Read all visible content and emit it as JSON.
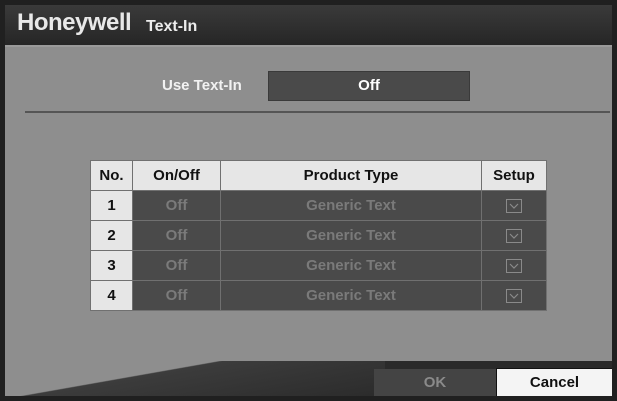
{
  "header": {
    "brand": "Honeywell",
    "title": "Text-In"
  },
  "use_text_in": {
    "label": "Use Text-In",
    "value": "Off"
  },
  "table": {
    "headers": [
      "No.",
      "On/Off",
      "Product Type",
      "Setup"
    ],
    "rows": [
      {
        "no": "1",
        "state": "Off",
        "product": "Generic Text",
        "setup_icon": "setup-check-icon"
      },
      {
        "no": "2",
        "state": "Off",
        "product": "Generic Text",
        "setup_icon": "setup-check-icon"
      },
      {
        "no": "3",
        "state": "Off",
        "product": "Generic Text",
        "setup_icon": "setup-check-icon"
      },
      {
        "no": "4",
        "state": "Off",
        "product": "Generic Text",
        "setup_icon": "setup-check-icon"
      }
    ]
  },
  "buttons": {
    "ok": "OK",
    "cancel": "Cancel"
  }
}
